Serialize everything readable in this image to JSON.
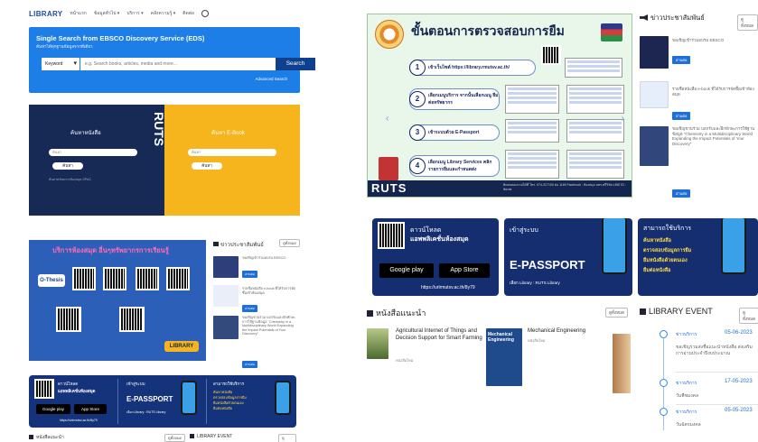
{
  "left": {
    "nav": {
      "logo": "LIBRARY",
      "items": [
        "หน้าแรก",
        "ข้อมูลทั่วไป ▾",
        "บริการ ▾",
        "คลังความรู้ ▾",
        "ติดต่อ"
      ]
    },
    "eds": {
      "title": "Single Search from EBSCO Discovery Service (EDS)",
      "subtitle": "ค้นหาได้ทุกฐานข้อมูลจากที่เดียว",
      "select_value": "Keyword",
      "placeholder": "e.g. Search books, articles, media and more...",
      "search_label": "Search",
      "advanced": "Advanced Search"
    },
    "hero": {
      "left_title": "ค้นหาหนังสือ",
      "right_title": "ค้นหา E-Book",
      "left_input": "ค้นหา",
      "right_input": "ค้นหา",
      "left_btn": "ค้นหา",
      "right_btn": "ค้นหา",
      "brand": "RUTS",
      "foot_left": "ค้นหาทรัพยากรห้องสมุด OPAC"
    },
    "banner": {
      "title": "บริการห้องสมุด อื่นๆทรัพยากรการเรียนรู้",
      "thesis": "O-Thesis",
      "library": "LIBRARY"
    },
    "news": {
      "title": "ข่าวประชาสัมพันธ์",
      "more": "ดูทั้งหมด",
      "items": [
        {
          "text": "ขอเชิญเข้าร่วมอบรม EBSCO",
          "btn": "อ่านต่อ"
        },
        {
          "text": "รายชื่อหนังสือ e-book ที่ได้รับการจัดซื้อเข้าห้องสมุด",
          "btn": "อ่านต่อ"
        },
        {
          "text": "ขอเชิญชวนร่วม บอกรับและฝึกทักษะการใช้ฐานข้อมูล \"Chemistry in a Multidisciplinary World Expanding the Impact Potentials of Your Discovery\"",
          "btn": "อ่านต่อ"
        }
      ]
    },
    "app": {
      "download": "ดาวน์โหลด",
      "app_name": "แอพพลิเคชั่นห้องสมุด",
      "google": "Google play",
      "apple": "App Store",
      "url": "https://urlrmutsv.ac.th/8y79",
      "login": "เข้าสู่ระบบ",
      "epassport": "E-PASSPORT",
      "epassport_sub": "เลือก Library : RUTS Library",
      "services_h": "สามารถใช้บริการ",
      "services": [
        "ค้นหาหนังสือ",
        "ตรวจสอบข้อมูลการยืม",
        "ยืมหนังสือด้วยตนเอง",
        "ยืมต่อหนังสือ"
      ]
    },
    "bottom": {
      "rec": "หนังสือแนะนำ",
      "rec_more": "ดูทั้งหมด",
      "event": "LIBRARY EVENT",
      "event_more": "ดูทั้งหมด"
    }
  },
  "right": {
    "inspect": {
      "title": "ขั้นตอนการตรวจสอบการยืม",
      "steps": [
        "เข้าเว็บไซต์ https://library.rmutsv.ac.th/",
        "เลือกเมนูบริการ จากนั้นเลือกเมนู ยืมต่อทรัพยากร",
        "เข้าระบบด้วย E-Passport",
        "เลือกเมนู Library Services คลิก รายการยืมและกำหนดส่ง"
      ],
      "brand": "RUTS",
      "foot": "ติดต่อสอบถามได้ที่ โทร. 074-317100 ต่อ 1169  Facebook : ห้องสมุด มทร.ศรีวิชัย  LINE ID : libruts"
    },
    "news": {
      "title": "ข่าวประชาสัมพันธ์",
      "more": "ดูทั้งหมด",
      "items": [
        {
          "text": "ขอเชิญเข้าร่วมอบรม EBSCO",
          "btn": "อ่านต่อ"
        },
        {
          "text": "รายชื่อหนังสือ e-book ที่ได้รับการจัดซื้อเข้าห้องสมุด",
          "btn": "อ่านต่อ"
        },
        {
          "text": "ขอเชิญชวนร่วม บอกรับและฝึกทักษะการใช้ฐานข้อมูล \"Chemistry in a Multidisciplinary World Expanding the Impact Potentials of Your Discovery\"",
          "btn": "อ่านต่อ"
        }
      ]
    },
    "app": {
      "download": "ดาวน์โหลด",
      "app_name": "แอพพลิเคชั่นห้องสมุด",
      "google": "Google play",
      "apple": "App Store",
      "url": "https://urlrmutsv.ac.th/8y79",
      "login": "เข้าสู่ระบบ",
      "epassport": "E-PASSPORT",
      "epassport_sub": "เลือก Library : RUTS Library",
      "services_h": "สามารถใช้บริการ",
      "services": [
        "ค้นหาหนังสือ",
        "ตรวจสอบข้อมูลการยืม",
        "ยืมหนังสือด้วยตนเอง",
        "ยืมต่อหนังสือ"
      ]
    },
    "recommended": {
      "title": "หนังสือแนะนำ",
      "more": "ดูทั้งหมด",
      "books": [
        {
          "title": "Agricultural Internet of Things and Decision Support for Smart Farming",
          "meta": "หนังสือใหม่"
        },
        {
          "title": "Mechanical Engineering",
          "meta": "หนังสือใหม่",
          "cover": "Mechanical Engineering"
        }
      ]
    },
    "event": {
      "title": "LIBRARY EVENT",
      "more": "ดูทั้งหมด",
      "items": [
        {
          "cat": "ข่าวบริการ",
          "date": "05-06-2023",
          "text": "ขอเชิญร่วมส่งชื่อแนะนำหนังสือ ส่งเสริมการอ่านประจำปีงบประมาณ"
        },
        {
          "cat": "ข่าวบริการ",
          "date": "17-05-2023",
          "text": "วันพืชมงคล"
        },
        {
          "cat": "ข่าวบริการ",
          "date": "05-05-2023",
          "text": "วันฉัตรมงคล"
        }
      ]
    }
  },
  "colors": {
    "eds_blue": "#1d7ee8",
    "navy": "#162a55",
    "gold": "#f6b51c",
    "link_blue": "#1e6fd8"
  }
}
